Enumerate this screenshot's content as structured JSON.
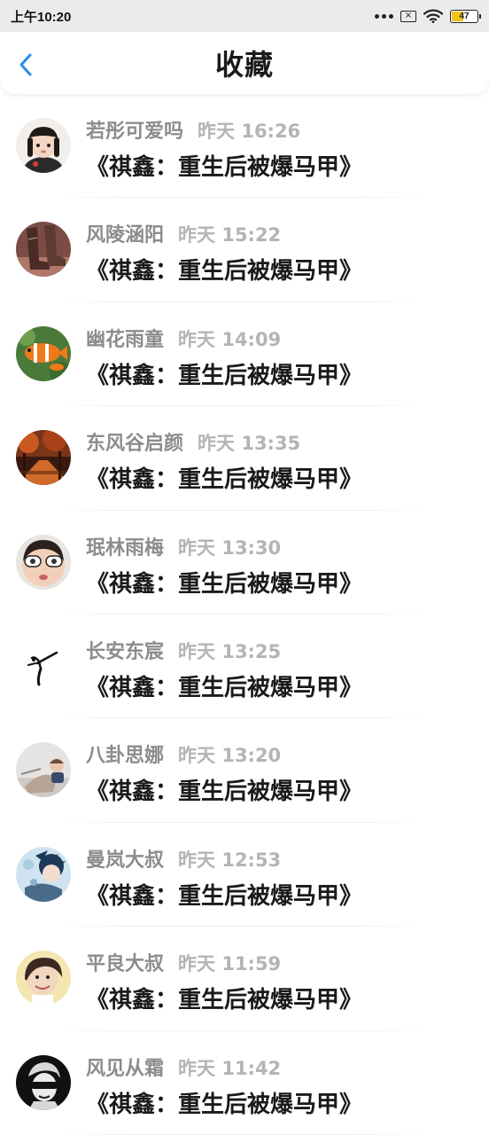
{
  "status_bar": {
    "time": "上午10:20",
    "battery": "47",
    "sim_label": "×"
  },
  "header": {
    "title": "收藏",
    "back_icon": "chevron-left-icon",
    "accent": "#2a8ce8"
  },
  "items": [
    {
      "author": "若彤可爱吗",
      "time": "昨天 16:26",
      "title": "《祺鑫：重生后被爆马甲》"
    },
    {
      "author": "风陵涵阳",
      "time": "昨天 15:22",
      "title": "《祺鑫：重生后被爆马甲》"
    },
    {
      "author": "幽花雨童",
      "time": "昨天 14:09",
      "title": "《祺鑫：重生后被爆马甲》"
    },
    {
      "author": "东风谷启颜",
      "time": "昨天 13:35",
      "title": "《祺鑫：重生后被爆马甲》"
    },
    {
      "author": "珉林雨梅",
      "time": "昨天 13:30",
      "title": "《祺鑫：重生后被爆马甲》"
    },
    {
      "author": "长安东宸",
      "time": "昨天 13:25",
      "title": "《祺鑫：重生后被爆马甲》"
    },
    {
      "author": "八卦思娜",
      "time": "昨天 13:20",
      "title": "《祺鑫：重生后被爆马甲》"
    },
    {
      "author": "曼岚大叔",
      "time": "昨天 12:53",
      "title": "《祺鑫：重生后被爆马甲》"
    },
    {
      "author": "平良大叔",
      "time": "昨天 11:59",
      "title": "《祺鑫：重生后被爆马甲》"
    },
    {
      "author": "风见从霜",
      "time": "昨天 11:42",
      "title": "《祺鑫：重生后被爆马甲》"
    }
  ]
}
